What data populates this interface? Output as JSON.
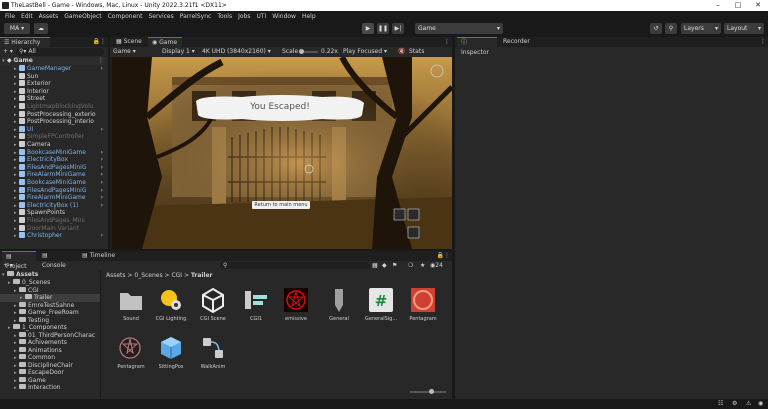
{
  "window": {
    "title": "TheLastBell - Game - Windows, Mac, Linux - Unity 2022.3.21f1 <DX11>"
  },
  "menu": [
    "File",
    "Edit",
    "Assets",
    "GameObject",
    "Component",
    "Services",
    "ParrelSync",
    "Tools",
    "Jobs",
    "UTI",
    "Window",
    "Help"
  ],
  "toolbar": {
    "account": "MA",
    "game_dropdown": "Game",
    "layers": "Layers",
    "layout": "Layout"
  },
  "hierarchy": {
    "tab": "Hierarchy",
    "search_placeholder": "All",
    "root": "Game",
    "items": [
      {
        "label": "GameManager",
        "style": "blue",
        "icon": "cube-icon"
      },
      {
        "label": "Sun",
        "style": "normal",
        "icon": "cube-icon"
      },
      {
        "label": "Exterior",
        "style": "normal",
        "icon": "cube-icon"
      },
      {
        "label": "Interior",
        "style": "normal",
        "icon": "cube-icon"
      },
      {
        "label": "Street",
        "style": "normal",
        "icon": "cube-icon"
      },
      {
        "label": "LightmapBlockingVolu",
        "style": "dim",
        "icon": "cube-icon"
      },
      {
        "label": "PostProcessing_exterio",
        "style": "normal",
        "icon": "cube-icon"
      },
      {
        "label": "PostProcessing_interio",
        "style": "normal",
        "icon": "cube-icon"
      },
      {
        "label": "UI",
        "style": "blue",
        "icon": "cube-icon"
      },
      {
        "label": "SimpleFPController",
        "style": "dim",
        "icon": "cube-icon"
      },
      {
        "label": "Camera",
        "style": "normal",
        "icon": "cube-icon"
      },
      {
        "label": "BookcaseMiniGame",
        "style": "blue",
        "icon": "cube-icon"
      },
      {
        "label": "ElectricityBox",
        "style": "blue",
        "icon": "cube-icon"
      },
      {
        "label": "FilesAndPagesMiniG",
        "style": "blue",
        "icon": "cube-icon"
      },
      {
        "label": "FireAlarmMiniGame",
        "style": "blue",
        "icon": "cube-icon"
      },
      {
        "label": "BookcaseMiniGame",
        "style": "blue",
        "icon": "cube-icon"
      },
      {
        "label": "FilesAndPagesMiniG",
        "style": "blue",
        "icon": "cube-icon"
      },
      {
        "label": "FireAlarmMiniGame",
        "style": "blue",
        "icon": "cube-icon"
      },
      {
        "label": "ElectricityBox (1)",
        "style": "blue",
        "icon": "cube-icon"
      },
      {
        "label": "SpawnPoints",
        "style": "normal",
        "icon": "cube-icon"
      },
      {
        "label": "FilesAndPages_Mini",
        "style": "dim",
        "icon": "cube-icon"
      },
      {
        "label": "DoorMain Variant",
        "style": "dim",
        "icon": "cube-icon"
      },
      {
        "label": "Christopher",
        "style": "blue",
        "icon": "cube-icon"
      }
    ]
  },
  "scene_tabs": {
    "scene": "Scene",
    "game": "Game"
  },
  "game_bar": {
    "mode": "Game",
    "display": "Display 1",
    "resolution": "4K UHD (3840x2160)",
    "scale_label": "Scale",
    "scale_value": "0.22x",
    "play_focused": "Play Focused",
    "stats": "Stats"
  },
  "game_view": {
    "banner": "You Escaped!",
    "button": "Return to main menu"
  },
  "inspector": {
    "tab": "Inspector",
    "recorder": "Recorder"
  },
  "bottom_tabs": {
    "project": "Project",
    "console": "Console",
    "timeline": "Timeline"
  },
  "project_tree": {
    "root": "Assets",
    "items": [
      {
        "label": "0_Scenes",
        "indent": 1
      },
      {
        "label": "CGI",
        "indent": 2
      },
      {
        "label": "Trailer",
        "indent": 3,
        "selected": true
      },
      {
        "label": "EmreTestSahne",
        "indent": 2
      },
      {
        "label": "Game_FreeRoam",
        "indent": 2
      },
      {
        "label": "Testing",
        "indent": 2
      },
      {
        "label": "1_Components",
        "indent": 1
      },
      {
        "label": "01_ThirdPersonCharac",
        "indent": 2
      },
      {
        "label": "Achivements",
        "indent": 2
      },
      {
        "label": "Animations",
        "indent": 2
      },
      {
        "label": "Common",
        "indent": 2
      },
      {
        "label": "DisciplineChair",
        "indent": 2
      },
      {
        "label": "EscapeDoor",
        "indent": 2
      },
      {
        "label": "Game",
        "indent": 2
      },
      {
        "label": "Interaction",
        "indent": 2
      }
    ]
  },
  "breadcrumb": [
    "Assets",
    "0_Scenes",
    "CGI",
    "Trailer"
  ],
  "hidden_count": "24",
  "assets": [
    {
      "label": "Sound",
      "icon": "folder-icon"
    },
    {
      "label": "CGI Lighting",
      "icon": "lighting-settings-icon"
    },
    {
      "label": "CGI Scene",
      "icon": "unity-scene-icon"
    },
    {
      "label": "CGI1",
      "icon": "timeline-icon"
    },
    {
      "label": "emissive",
      "icon": "material-icon"
    },
    {
      "label": "General",
      "icon": "prefab-icon"
    },
    {
      "label": "GeneralSig...",
      "icon": "csharp-script-icon"
    },
    {
      "label": "Pentagram",
      "icon": "texture-icon"
    },
    {
      "label": "Pentagram",
      "icon": "pentagram-prefab-icon"
    },
    {
      "label": "SittingPos",
      "icon": "prefab-cube-icon"
    },
    {
      "label": "WalkAnim",
      "icon": "anim-graph-icon"
    }
  ],
  "colors": {
    "accent": "#3a79bb",
    "blue_text": "#7fb4ec",
    "panel": "#282828"
  }
}
